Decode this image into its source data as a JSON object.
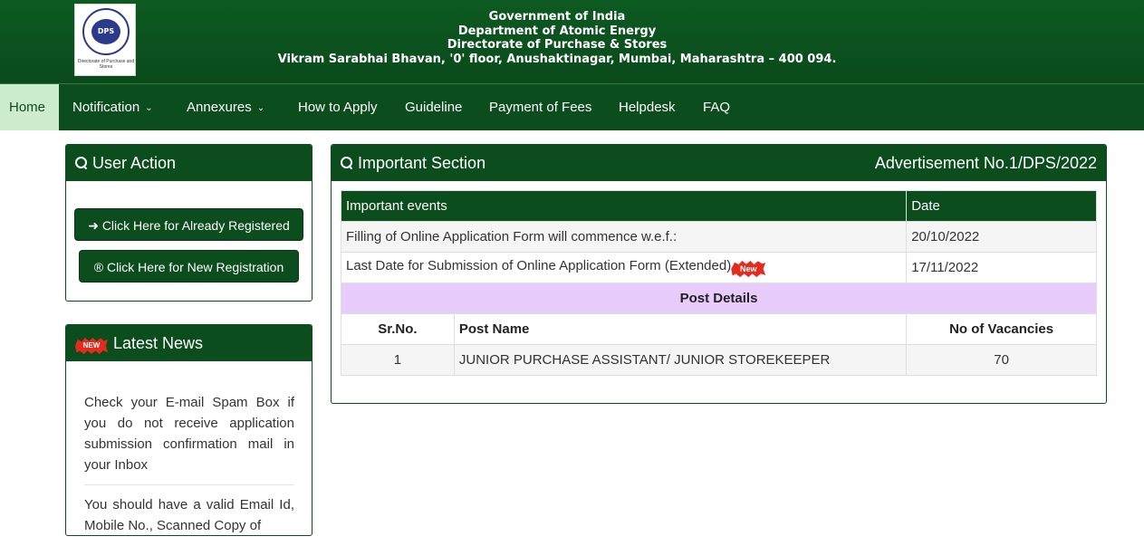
{
  "header": {
    "line1": "Government of India",
    "line2": "Department of Atomic Energy",
    "line3": "Directorate of Purchase & Stores",
    "line4": "Vikram Sarabhai Bhavan, '0' floor, Anushaktinagar, Mumbai, Maharashtra – 400 094."
  },
  "logo": {
    "center_text": "DPS",
    "caption": "Directorate of Purchase and Stores"
  },
  "nav": {
    "home": "Home",
    "notification": "Notification",
    "annexures": "Annexures",
    "how_to_apply": "How to Apply",
    "guideline": "Guideline",
    "payment": "Payment of Fees",
    "helpdesk": "Helpdesk",
    "faq": "FAQ"
  },
  "user_action": {
    "title": "User Action",
    "registered_btn": "Click Here for Already Registered",
    "new_reg_btn": "Click Here for New Registration"
  },
  "latest_news": {
    "title": "Latest News",
    "badge": "NEW",
    "items": [
      "Check your E-mail Spam Box if you do not receive application submission confirmation mail in your Inbox",
      "You should have a valid Email Id, Mobile No., Scanned Copy of"
    ]
  },
  "important": {
    "title": "Important Section",
    "advertisement": "Advertisement No.1/DPS/2022",
    "events_header": "Important events",
    "date_header": "Date",
    "events": [
      {
        "label": "Filling of Online Application Form will commence w.e.f.:",
        "date": "20/10/2022"
      },
      {
        "label": "Last Date for Submission of Online Application Form (Extended)",
        "date": "17/11/2022",
        "badge": "New"
      }
    ],
    "post_details_title": "Post Details",
    "post_headers": {
      "sr": "Sr.No.",
      "name": "Post Name",
      "vacancies": "No of Vacancies"
    },
    "posts": [
      {
        "sr": "1",
        "name": "JUNIOR PURCHASE ASSISTANT/ JUNIOR STOREKEEPER",
        "vacancies": "70"
      }
    ]
  },
  "colors": {
    "primary_green": "#0b4d1c",
    "active_nav": "#cdeccd",
    "post_details_bg": "#e8ccfb",
    "badge_red": "#e62b1e"
  }
}
